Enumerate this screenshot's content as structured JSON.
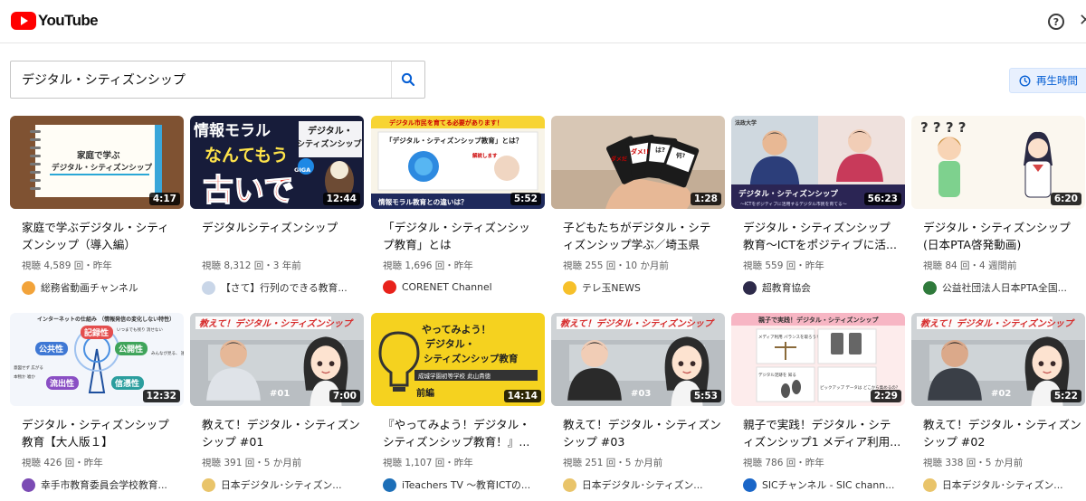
{
  "app": {
    "logo_text": "YouTube"
  },
  "search": {
    "query": "デジタル・シティズンシップ"
  },
  "filter": {
    "duration_label": "再生時間"
  },
  "videos": [
    {
      "thumb_text": [
        "家庭で学ぶ",
        "デジタル・シティズンシップ"
      ],
      "duration": "4:17",
      "title": "家庭で学ぶデジタル・シティズンシップ（導入編）",
      "meta": "視聴 4,589 回・昨年",
      "channel": "総務省動画チャンネル",
      "chan_color": "#f2a33a"
    },
    {
      "thumb_text": [
        "情報モラル",
        "なんてもう",
        "古いで",
        "デジタル・",
        "シティズンシップ",
        "GIGA"
      ],
      "duration": "12:44",
      "title": "デジタルシティズンシップ",
      "meta": "視聴 8,312 回・3 年前",
      "channel": "【さて】行列のできる教育...",
      "chan_color": "#c9d6e8"
    },
    {
      "thumb_text": [
        "デジタル市民を育てる必要があります！",
        "「デジタル・シティズンシップ教育」とは？",
        "情報モラル教育との違いは？",
        "解説します"
      ],
      "duration": "5:52",
      "title": "「デジタル・シティズンシップ教育」とは",
      "meta": "視聴 1,696 回・昨年",
      "channel": "CORENET Channel",
      "chan_color": "#e8221b"
    },
    {
      "thumb_text": [
        "ダメ!!",
        "は?",
        "何?",
        "ダメだ"
      ],
      "duration": "1:28",
      "title": "子どもたちがデジタル・シティズンシップ学ぶ／埼玉県",
      "meta": "視聴 255 回・10 か月前",
      "channel": "テレ玉NEWS",
      "chan_color": "#f6c02a"
    },
    {
      "thumb_text": [
        "法政大学",
        "デジタル・シティズンシップ",
        "～ICTをポジティブに活用するデジタル市民を育てる～"
      ],
      "duration": "56:23",
      "title": "デジタル・シティズンシップ教育～ICTをポジティブに活...",
      "meta": "視聴 559 回・昨年",
      "channel": "超教育協会",
      "chan_color": "#2d2a4a"
    },
    {
      "thumb_text": [
        "? ? ? ?"
      ],
      "duration": "6:20",
      "title": "デジタル・シティズンシップ(日本PTA啓発動画)",
      "meta": "視聴 84 回・4 週間前",
      "channel": "公益社団法人日本PTA全国...",
      "chan_color": "#2f7a3b"
    },
    {
      "thumb_text": [
        "インターネットの仕組み （情報発信の変化しない特性）",
        "記録性",
        "公共性",
        "公開性",
        "流出性",
        "信憑性",
        "いつまでも残り 消せない",
        "みんなが見る、 誰に見られても",
        "意図せず 広がる",
        "本物か 嘘か"
      ],
      "duration": "12:32",
      "title": "デジタル・シティズンシップ教育【大人版１】",
      "meta": "視聴 426 回・昨年",
      "channel": "幸手市教育委員会学校教育...",
      "chan_color": "#7b4bb4"
    },
    {
      "thumb_text": [
        "教えて！デジタル・シティズンシップ",
        "#01"
      ],
      "duration": "7:00",
      "title": "教えて！デジタル・シティズンシップ #01",
      "meta": "視聴 391 回・5 か月前",
      "channel": "日本デジタル･シティズン...",
      "chan_color": "#e9c46a"
    },
    {
      "thumb_text": [
        "やってみよう！",
        "デジタル・",
        "シティズンシップ教育",
        "成城学園初等学校 此山貴徳",
        "前編"
      ],
      "duration": "14:14",
      "title": "『やってみよう！デジタル・シティズンシップ教育！』...",
      "meta": "視聴 1,107 回・昨年",
      "channel": "iTeachers TV ～教育ICTの...",
      "chan_color": "#1d6fb8"
    },
    {
      "thumb_text": [
        "教えて！デジタル・シティズンシップ",
        "#03"
      ],
      "duration": "5:53",
      "title": "教えて！デジタル・シティズンシップ #03",
      "meta": "視聴 251 回・5 か月前",
      "channel": "日本デジタル･シティズン...",
      "chan_color": "#e9c46a"
    },
    {
      "thumb_text": [
        "親子で実践！デジタル・シティズンシップ",
        "メディア利用 バランスを取ろう！",
        "ピックアップ データは どこから集めるの？",
        "デジタル足跡を 知る"
      ],
      "duration": "2:29",
      "title": "親子で実践！デジタル・シティズンシップ1 メディア利用...",
      "meta": "視聴 786 回・昨年",
      "channel": "SICチャンネル - SIC chann...",
      "chan_color": "#1a66c8"
    },
    {
      "thumb_text": [
        "教えて！デジタル・シティズンシップ",
        "#02"
      ],
      "duration": "5:22",
      "title": "教えて！デジタル・シティズンシップ #02",
      "meta": "視聴 338 回・5 か月前",
      "channel": "日本デジタル･シティズン...",
      "chan_color": "#e9c46a"
    }
  ]
}
